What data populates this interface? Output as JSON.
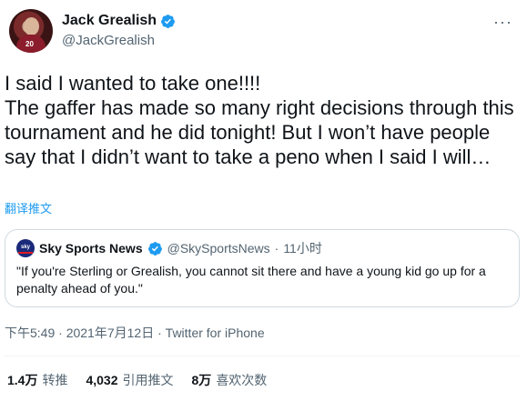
{
  "author": {
    "display_name": "Jack Grealish",
    "handle": "@JackGrealish",
    "avatar_number": "20",
    "verified": true
  },
  "more_icon": "ellipsis-icon",
  "tweet": {
    "text": "I said I wanted to take one!!!!\nThe gaffer has made so many right decisions through this tournament and he did tonight! But I won’t have people say that I didn’t want to take a peno when I said I will…",
    "translate_label": "翻译推文"
  },
  "quote": {
    "avatar_text": "sky",
    "display_name": "Sky Sports News",
    "handle": "@SkySportsNews",
    "separator": "·",
    "time": "11小时",
    "text": "\"If you're Sterling or Grealish, you cannot sit there and have a young kid go up for a penalty ahead of you.\""
  },
  "meta": {
    "time": "下午5:49",
    "sep1": "·",
    "date": "2021年7月12日",
    "sep2": "·",
    "source": "Twitter for iPhone"
  },
  "stats": {
    "retweets_value": "1.4万",
    "retweets_label": "转推",
    "quotes_value": "4,032",
    "quotes_label": "引用推文",
    "likes_value": "8万",
    "likes_label": "喜欢次数"
  },
  "colors": {
    "verified_blue": "#1d9bf0",
    "link_blue": "#1d9bf0",
    "secondary_text": "#536471"
  }
}
